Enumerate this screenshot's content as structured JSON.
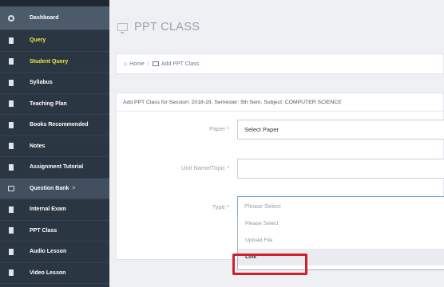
{
  "sidebar": {
    "items": [
      {
        "label": "Dashboard",
        "icon": "gauge-icon",
        "color": "#ffffff"
      },
      {
        "label": "Query",
        "icon": "document-icon",
        "color": "#f0e34c"
      },
      {
        "label": "Student Query",
        "icon": "document-icon",
        "color": "#f0e34c"
      },
      {
        "label": "Syllabus",
        "icon": "document-icon",
        "color": "#ffffff"
      },
      {
        "label": "Teaching Plan",
        "icon": "document-icon",
        "color": "#ffffff"
      },
      {
        "label": "Books Recommended",
        "icon": "document-icon",
        "color": "#ffffff"
      },
      {
        "label": "Notes",
        "icon": "document-icon",
        "color": "#ffffff"
      },
      {
        "label": "Assignment Tutorial",
        "icon": "document-icon",
        "color": "#ffffff"
      },
      {
        "label": "Question Bank",
        "icon": "monitor-icon",
        "color": "#ffffff",
        "arrow": ">"
      },
      {
        "label": "Internal Exam",
        "icon": "document-icon",
        "color": "#ffffff"
      },
      {
        "label": "PPT Class",
        "icon": "document-icon",
        "color": "#ffffff"
      },
      {
        "label": "Audio Lesson",
        "icon": "document-icon",
        "color": "#ffffff"
      },
      {
        "label": "Video Lesson",
        "icon": "document-icon",
        "color": "#ffffff"
      }
    ]
  },
  "header": {
    "title": "PPT CLASS"
  },
  "breadcrumb": {
    "home": "Home",
    "current": "Add PPT Class"
  },
  "panel": {
    "heading": "Add PPT Class for Session: 2018-19, Semester: 5th Sem, Subject: COMPUTER SCIENCE"
  },
  "form": {
    "paper_label": "Paper",
    "paper_value": "Select Paper",
    "unit_label": "Unit Name/Topic",
    "unit_value": "",
    "type_label": "Type",
    "type_value": "Please Select",
    "required_mark": "*",
    "type_options": [
      "Please Select",
      "Upload File",
      "Link"
    ],
    "selected_option": "Link"
  },
  "colors": {
    "sidebar_bg": "#2b3643",
    "highlight": "#d01f2c",
    "yellow": "#f0e34c"
  }
}
